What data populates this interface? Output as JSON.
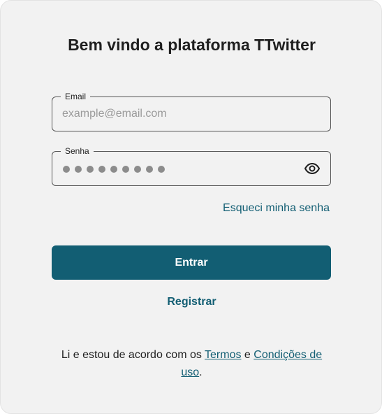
{
  "title": "Bem vindo a plataforma TTwitter",
  "email": {
    "label": "Email",
    "placeholder": "example@email.com",
    "value": ""
  },
  "password": {
    "label": "Senha",
    "masked_length": 9,
    "toggle_icon": "eye-icon"
  },
  "forgot_link": "Esqueci minha senha",
  "submit_label": "Entrar",
  "register_label": "Registrar",
  "terms": {
    "prefix": "Li e estou de acordo com os ",
    "terms_link": "Termos",
    "conjunction": " e ",
    "conditions_link_1": "Condições de",
    "conditions_link_2": "uso",
    "suffix": "."
  },
  "colors": {
    "accent": "#125e73",
    "card_bg": "#f2f2f2",
    "text": "#1f1f1f"
  }
}
